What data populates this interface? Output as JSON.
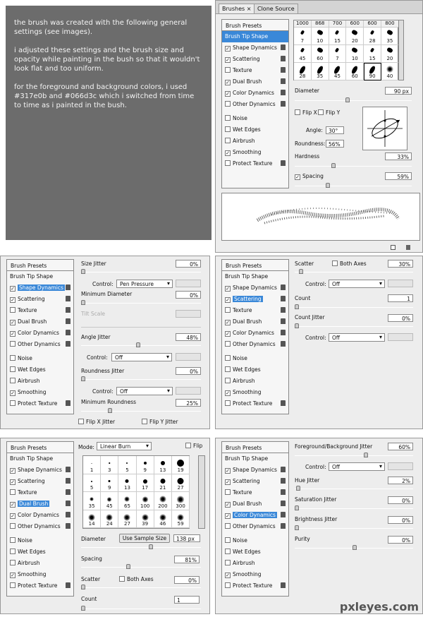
{
  "note": {
    "paragraphs": [
      "the brush was created with the following general settings (see images).",
      "i adjusted these settings and the brush size and opacity while painting in the bush so that it wouldn't look flat and too uniform.",
      "for the foreground and background colors, i used #317e0b and #066d3c which i switched from time to time as i painted in the bush."
    ]
  },
  "sidebar": {
    "presets": "Brush Presets",
    "tip": "Brush Tip Shape",
    "items": [
      "Shape Dynamics",
      "Scattering",
      "Texture",
      "Dual Brush",
      "Color Dynamics",
      "Other Dynamics",
      "Noise",
      "Wet Edges",
      "Airbrush",
      "Smoothing",
      "Protect Texture"
    ]
  },
  "p1": {
    "tabs": [
      "Brushes",
      "Clone Source"
    ],
    "checked": [
      true,
      true,
      false,
      true,
      true,
      false,
      false,
      false,
      false,
      true,
      false
    ],
    "grid_top": [
      "1000",
      "868",
      "700",
      "600",
      "600",
      "800"
    ],
    "grid_rows": [
      [
        "7",
        "10",
        "15",
        "20",
        "28",
        "35"
      ],
      [
        "45",
        "60",
        "7",
        "10",
        "15",
        "20"
      ],
      [
        "28",
        "35",
        "45",
        "60",
        "90",
        "40"
      ]
    ],
    "diameter_label": "Diameter",
    "diameter": "90 px",
    "flipx": "Flip X",
    "flipy": "Flip Y",
    "angle_label": "Angle:",
    "angle": "30°",
    "roundness_label": "Roundness:",
    "roundness": "56%",
    "hardness_label": "Hardness",
    "hardness": "33%",
    "spacing_label": "Spacing",
    "spacing": "59%"
  },
  "p2": {
    "size_jitter": "Size Jitter",
    "size_jitter_v": "0%",
    "control": "Control:",
    "ctrl1": "Pen Pressure",
    "min_diam": "Minimum Diameter",
    "min_diam_v": "0%",
    "tilt": "Tilt Scale",
    "angle_jitter": "Angle Jitter",
    "angle_jitter_v": "48%",
    "ctrl2": "Off",
    "round_jitter": "Roundness Jitter",
    "round_jitter_v": "0%",
    "ctrl3": "Off",
    "min_round": "Minimum Roundness",
    "min_round_v": "25%",
    "flipx": "Flip X Jitter",
    "flipy": "Flip Y Jitter"
  },
  "p3": {
    "scatter": "Scatter",
    "both": "Both Axes",
    "scatter_v": "30%",
    "control": "Control:",
    "ctrl1": "Off",
    "count": "Count",
    "count_v": "1",
    "count_jitter": "Count Jitter",
    "count_jitter_v": "0%",
    "ctrl2": "Off"
  },
  "p4": {
    "mode_label": "Mode:",
    "mode": "Linear Burn",
    "flip": "Flip",
    "grid": [
      [
        "1",
        "3",
        "5",
        "9",
        "13",
        "19"
      ],
      [
        "5",
        "9",
        "13",
        "17",
        "21",
        "27"
      ],
      [
        "35",
        "45",
        "65",
        "100",
        "200",
        "300"
      ],
      [
        "14",
        "24",
        "27",
        "39",
        "46",
        "59"
      ]
    ],
    "diameter_label": "Diameter",
    "use_sample": "Use Sample Size",
    "diameter": "138 px",
    "spacing_label": "Spacing",
    "spacing": "81%",
    "scatter_label": "Scatter",
    "both": "Both Axes",
    "scatter": "0%",
    "count_label": "Count",
    "count": "1"
  },
  "p5": {
    "fgbg": "Foreground/Background Jitter",
    "fgbg_v": "60%",
    "control": "Control:",
    "ctrl": "Off",
    "hue": "Hue Jitter",
    "hue_v": "2%",
    "sat": "Saturation Jitter",
    "sat_v": "0%",
    "bri": "Brightness Jitter",
    "bri_v": "0%",
    "pur": "Purity",
    "pur_v": "0%"
  },
  "watermark": "pxleyes.com",
  "colors": {
    "selection": "#3a88d8",
    "panel": "#ededed",
    "note_bg": "#6c6c6c"
  }
}
